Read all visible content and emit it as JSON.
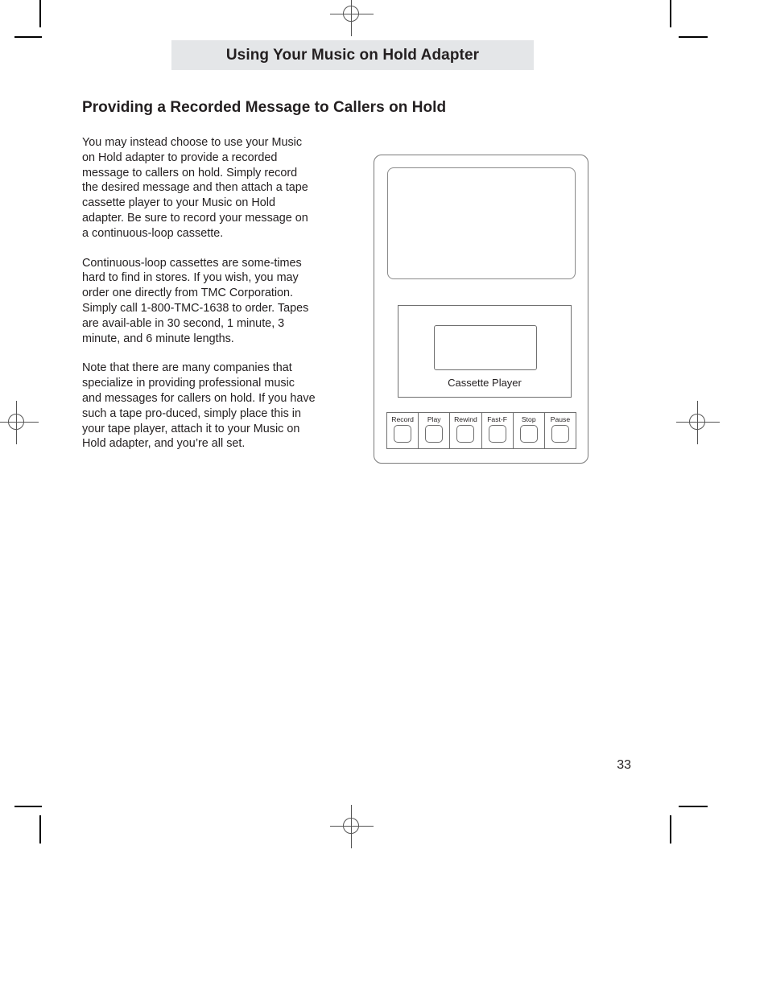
{
  "chapter": {
    "title": "Using Your Music on Hold Adapter"
  },
  "section": {
    "heading": "Providing a Recorded Message to Callers on Hold"
  },
  "body": {
    "paragraphs": [
      "You may instead choose to use your Music on Hold adapter to provide a recorded message to callers on hold. Simply record the desired message and then attach a tape cassette player to your Music on Hold adapter.  Be sure to record your message on a continuous-loop cassette.",
      "Continuous-loop cassettes are some-times hard to find in stores.  If you wish, you may order one directly from TMC Corporation.  Simply call 1-800-TMC-1638 to order.  Tapes are avail-able in 30 second, 1 minute, 3 minute, and 6 minute lengths.",
      "Note that there are many companies that specialize in providing professional music and messages for callers on hold.  If you have such a tape pro-duced, simply place this in your tape player, attach it to your Music on Hold adapter, and you’re all set."
    ]
  },
  "figure": {
    "deck_label": "Cassette Player",
    "buttons": [
      {
        "label": "Record"
      },
      {
        "label": "Play"
      },
      {
        "label": "Rewind"
      },
      {
        "label": "Fast-F"
      },
      {
        "label": "Stop"
      },
      {
        "label": "Pause"
      }
    ]
  },
  "footer": {
    "page_number": "33"
  },
  "colors": {
    "chapter_bar_background": "#e4e6e8",
    "text": "#231f20",
    "figure_stroke": "#6f6f6f",
    "crop_mark": "#000000",
    "registration_mark": "#555555"
  }
}
